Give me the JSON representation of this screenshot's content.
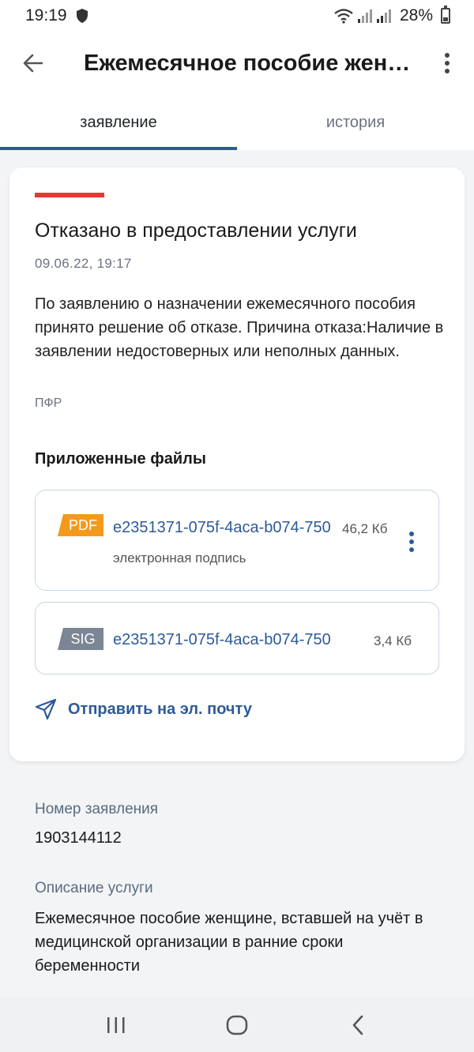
{
  "status_bar": {
    "time": "19:19",
    "battery": "28%"
  },
  "app_bar": {
    "title": "Ежемесячное пособие женщине, вставшей на учёт в медицинской организации в ранние сроки беременности"
  },
  "tabs": [
    {
      "label": "заявление",
      "active": true
    },
    {
      "label": "история",
      "active": false
    }
  ],
  "card": {
    "status_color": "#e53935",
    "title": "Отказано в предоставлении услуги",
    "date": "09.06.22, 19:17",
    "text": "По заявлению о назначении ежемесячного пособия принято решение об отказе. Причина отказа:Наличие в заявлении недостоверных или неполных данных.",
    "source": "ПФР",
    "files_heading": "Приложенные файлы",
    "files": [
      {
        "type": "PDF",
        "type_color": "#f39a1c",
        "name": "e2351371-075f-4aca-b074-750",
        "size": "46,2 Кб",
        "subtitle": "электронная подпись"
      },
      {
        "type": "SIG",
        "type_color": "#7b8594",
        "name": "e2351371-075f-4aca-b074-750",
        "size": "3,4 Кб"
      }
    ],
    "send_label": "Отправить на эл. почту"
  },
  "details": {
    "number_label": "Номер заявления",
    "number_value": "1903144112",
    "description_label": "Описание услуги",
    "description_value": "Ежемесячное пособие женщине, вставшей на учёт в медицинской организации в ранние сроки беременности"
  },
  "icons": {
    "back": "arrow-left-icon",
    "more": "more-vertical-icon",
    "send": "send-icon",
    "nav_recent": "recent-apps-icon",
    "nav_home": "home-icon",
    "nav_back": "chevron-left-icon"
  },
  "colors": {
    "accent": "#2d5a9a",
    "error": "#e53935"
  }
}
